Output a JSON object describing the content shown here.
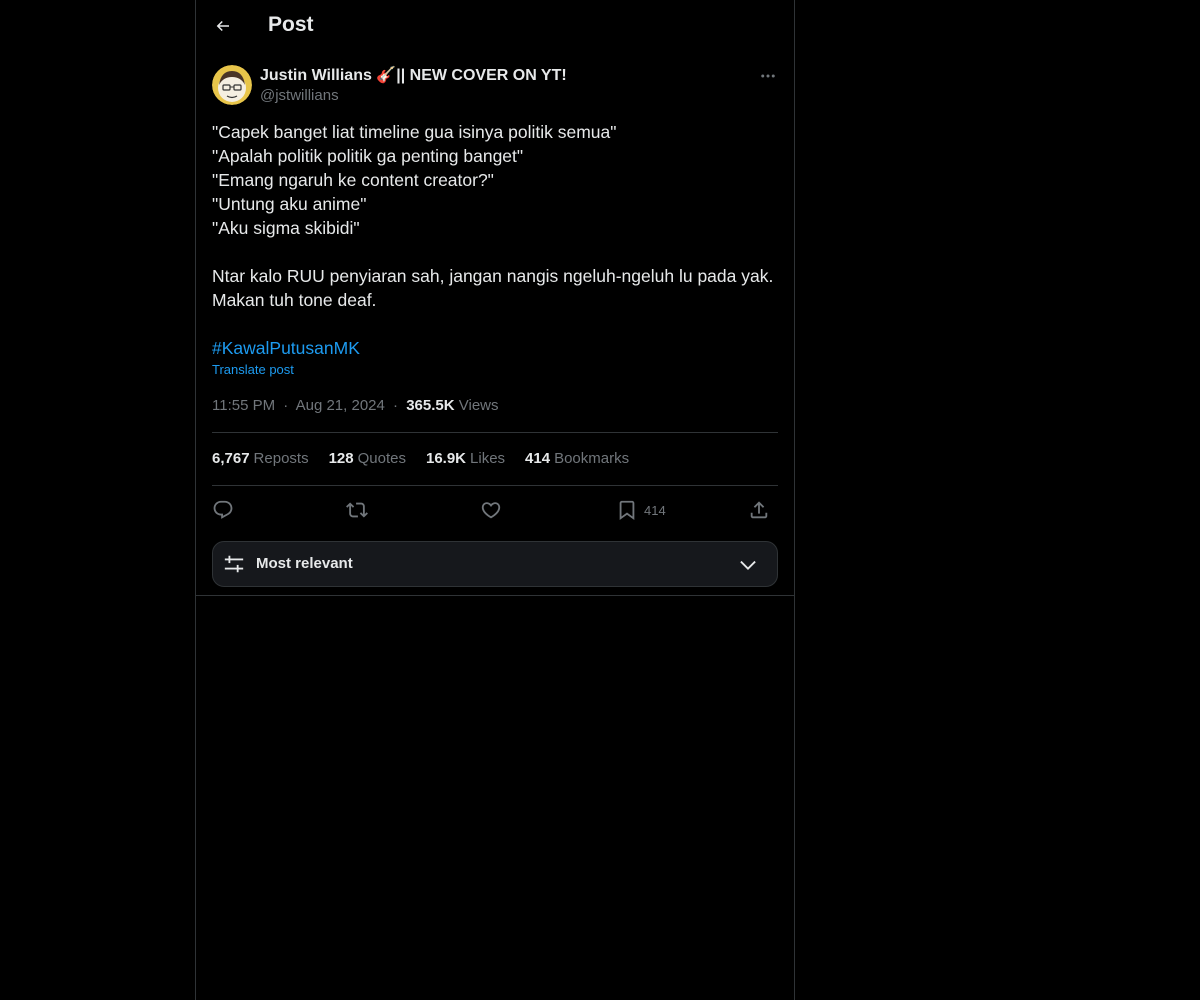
{
  "header": {
    "title": "Post",
    "back_icon": "arrow-left-icon"
  },
  "author": {
    "name": "Justin Willians 🎸|| NEW COVER ON YT!",
    "handle": "@jstwillians",
    "avatar_icon": "avatar-image"
  },
  "post": {
    "lines": [
      "\"Capek banget liat timeline gua isinya politik semua\"",
      "\"Apalah politik politik ga penting banget\"",
      "\"Emang ngaruh ke content creator?\"",
      "\"Untung aku anime\"",
      "\"Aku sigma skibidi\"",
      "",
      "Ntar kalo RUU penyiaran sah, jangan nangis ngeluh-ngeluh lu pada yak.",
      "Makan tuh tone deaf.",
      ""
    ],
    "hashtag": "#KawalPutusanMK",
    "translate_label": "Translate post"
  },
  "meta": {
    "time": "11:55 PM",
    "date": "Aug 21, 2024",
    "separator": "·",
    "views_count": "365.5K",
    "views_label": "Views"
  },
  "stats": [
    {
      "count": "6,767",
      "label": "Reposts"
    },
    {
      "count": "128",
      "label": "Quotes"
    },
    {
      "count": "16.9K",
      "label": "Likes"
    },
    {
      "count": "414",
      "label": "Bookmarks"
    }
  ],
  "actions": {
    "reply_icon": "reply-icon",
    "repost_icon": "repost-icon",
    "like_icon": "heart-icon",
    "bookmark_icon": "bookmark-icon",
    "bookmark_count": "414",
    "share_icon": "share-icon"
  },
  "sort": {
    "label": "Most relevant",
    "icon": "sliders-icon",
    "chevron": "chevron-down-icon"
  },
  "colors": {
    "background": "#000000",
    "text": "#e7e9ea",
    "muted": "#71767b",
    "accent": "#1d9bf0",
    "border": "#2f3336"
  }
}
